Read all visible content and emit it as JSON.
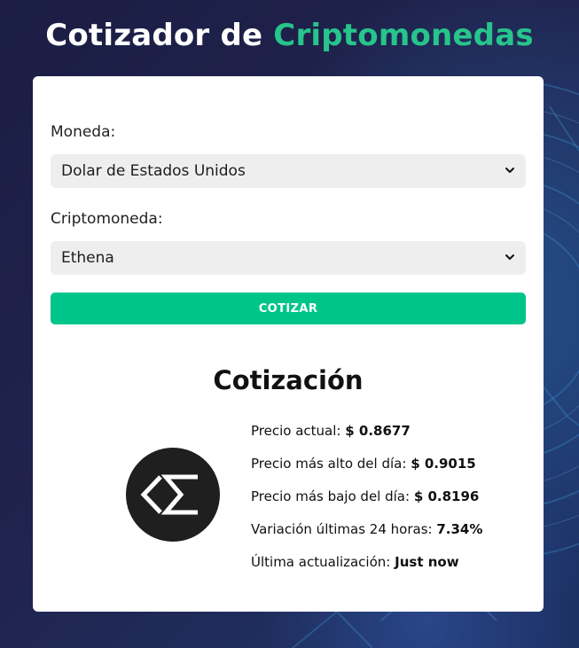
{
  "header": {
    "title_part1": "Cotizador de",
    "title_part2": "Criptomonedas",
    "accent_color": "#27c48b"
  },
  "form": {
    "currency_label": "Moneda:",
    "currency_selected": "Dolar de Estados Unidos",
    "crypto_label": "Criptomoneda:",
    "crypto_selected": "Ethena",
    "submit_label": "COTIZAR",
    "button_color": "#00c58a",
    "dropdown_icon": "chevron-down-icon"
  },
  "result": {
    "title": "Cotización",
    "logo_icon": "ethena-logo",
    "rows": [
      {
        "label": "Precio actual:",
        "value": "$ 0.8677"
      },
      {
        "label": "Precio más alto del día:",
        "value": "$ 0.9015"
      },
      {
        "label": "Precio más bajo del día:",
        "value": "$ 0.8196"
      },
      {
        "label": "Variación últimas 24 horas:",
        "value": "7.34%"
      },
      {
        "label": "Última actualización:",
        "value": "Just now"
      }
    ]
  }
}
